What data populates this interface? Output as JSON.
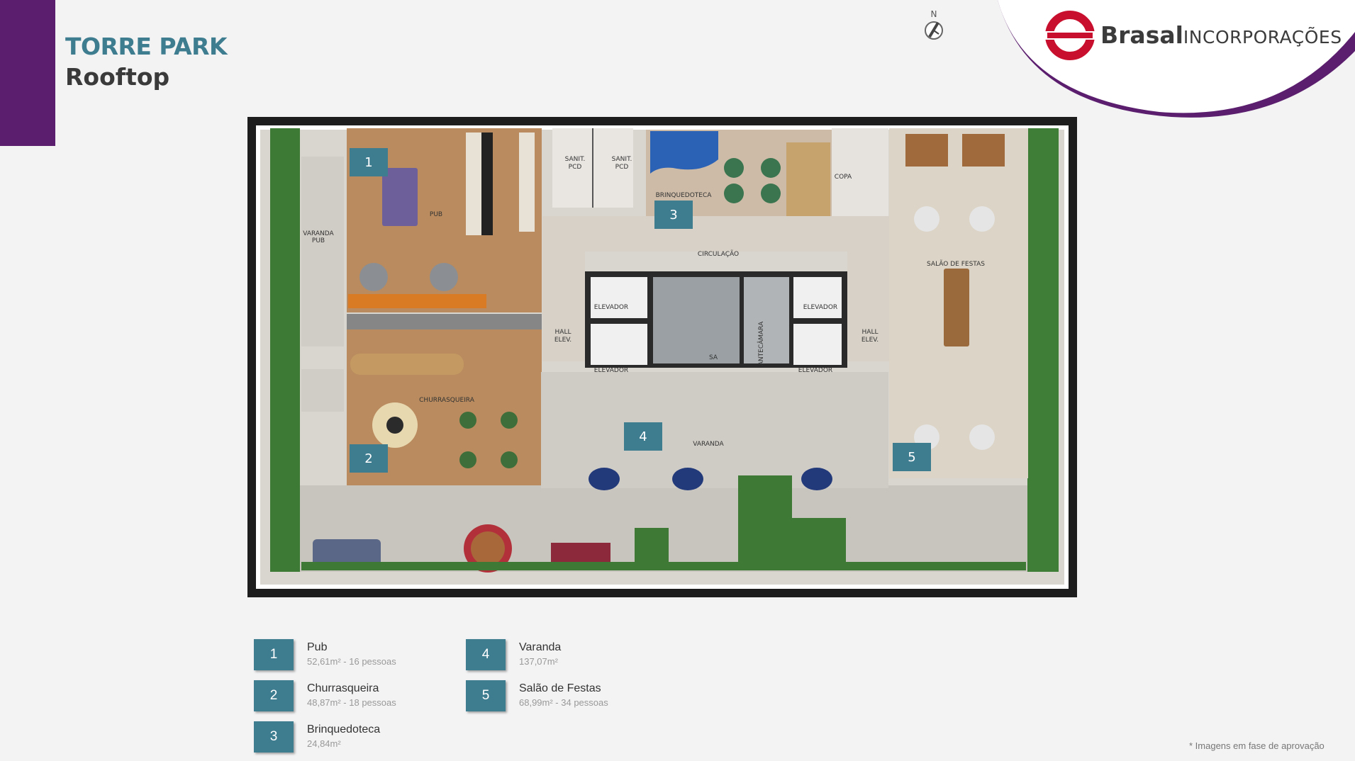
{
  "header": {
    "title": "TORRE PARK",
    "subtitle": "Rooftop"
  },
  "brand": {
    "name_bold": "Brasal",
    "name_light": "INCORPORAÇÕES",
    "color_red": "#c8102e",
    "color_purple": "#5b1e6e"
  },
  "compass": {
    "label": "N"
  },
  "plan": {
    "markers": [
      "1",
      "2",
      "3",
      "4",
      "5"
    ],
    "rooms": {
      "pub": "PUB",
      "varanda_pub": [
        "VARANDA",
        "PUB"
      ],
      "sanit_1": [
        "SANIT.",
        "PCD"
      ],
      "sanit_2": [
        "SANIT.",
        "PCD"
      ],
      "brinquedoteca": "BRINQUEDOTECA",
      "copa": "COPA",
      "circulacao": "CIRCULAÇÃO",
      "salao_festas": "SALÃO DE FESTAS",
      "elevador_1": "ELEVADOR",
      "elevador_2": "ELEVADOR",
      "elevador_3": "ELEVADOR",
      "elevador_4": "ELEVADOR",
      "hall_left": [
        "HALL",
        "ELEV."
      ],
      "hall_right": [
        "HALL",
        "ELEV."
      ],
      "sa": "SA",
      "antecamara": "ANTECÂMARA",
      "churrasqueira": "CHURRASQUEIRA",
      "varanda": "VARANDA"
    }
  },
  "legend": [
    {
      "num": "1",
      "name": "Pub",
      "detail": "52,61m² - 16 pessoas"
    },
    {
      "num": "2",
      "name": "Churrasqueira",
      "detail": "48,87m² - 18 pessoas"
    },
    {
      "num": "3",
      "name": "Brinquedoteca",
      "detail": "24,84m²"
    },
    {
      "num": "4",
      "name": "Varanda",
      "detail": "137,07m²"
    },
    {
      "num": "5",
      "name": "Salão de Festas",
      "detail": "68,99m² - 34 pessoas"
    }
  ],
  "footnote": "* Imagens em fase de aprovação"
}
